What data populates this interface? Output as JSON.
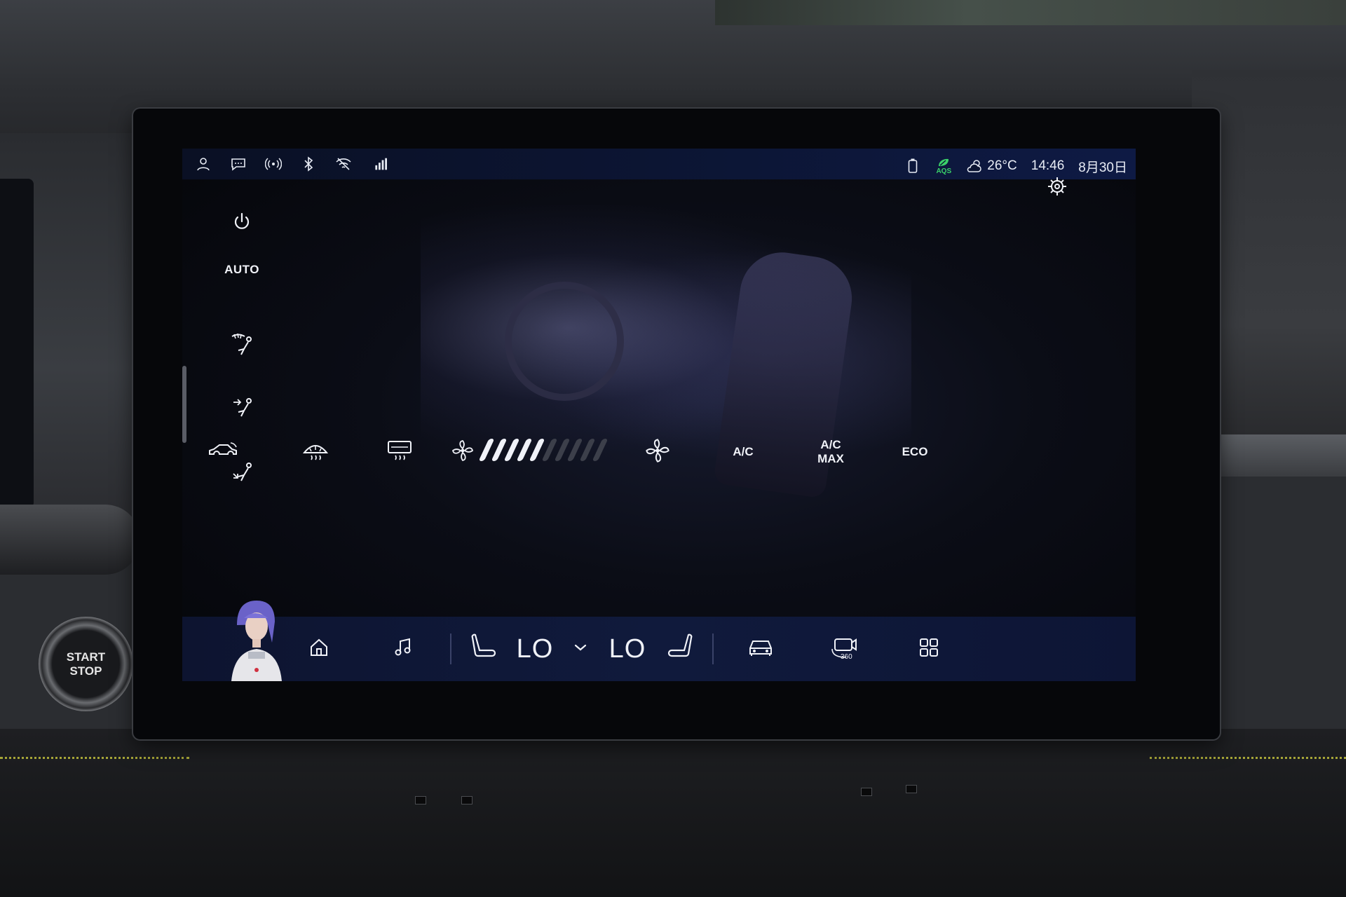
{
  "status_bar": {
    "left_icons": [
      "user-icon",
      "chat-icon",
      "broadcast-icon",
      "bluetooth-icon",
      "wifi-off-icon",
      "signal-icon"
    ],
    "aqs_label": "AQS",
    "weather_temp": "26°C",
    "time": "14:46",
    "date": "8月30日"
  },
  "climate_left": {
    "auto_label": "AUTO"
  },
  "climate_row": {
    "ac_label": "A/C",
    "ac_max_label_line1": "A/C",
    "ac_max_label_line2": "MAX",
    "eco_label": "ECO",
    "fan_level": 5,
    "fan_max": 10
  },
  "dock": {
    "driver_temp": "LO",
    "passenger_temp": "LO"
  },
  "start_button": {
    "line1": "START",
    "line2": "STOP"
  },
  "colors": {
    "screen_bg": "#05060a",
    "icon_white": "#f0f2f8",
    "aqs_green": "#3ad26a",
    "dock_bg": "#101a3c"
  }
}
